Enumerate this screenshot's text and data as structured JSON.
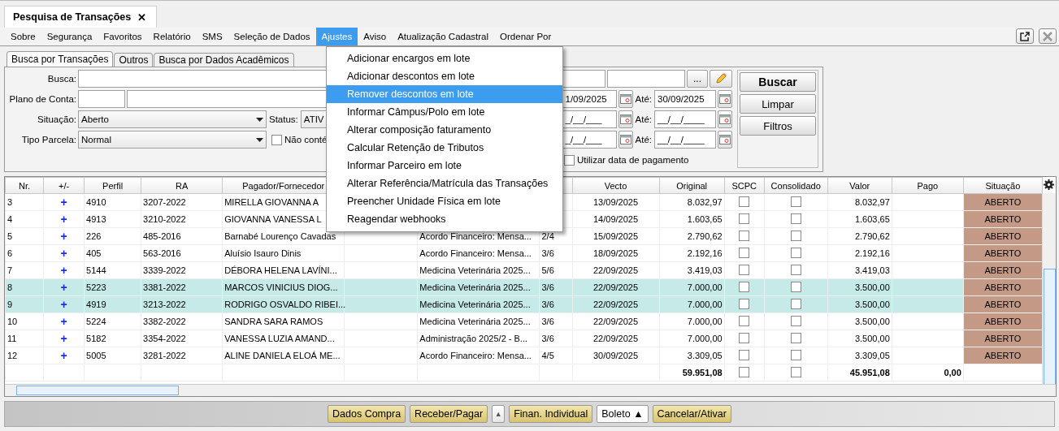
{
  "doc_tab": {
    "title": "Pesquisa de Transações",
    "close": "✕"
  },
  "menubar": [
    {
      "label": "Sobre",
      "selected": false
    },
    {
      "label": "Segurança",
      "selected": false
    },
    {
      "label": "Favoritos",
      "selected": false
    },
    {
      "label": "Relatório",
      "selected": false
    },
    {
      "label": "SMS",
      "selected": false
    },
    {
      "label": "Seleção de Dados",
      "selected": false
    },
    {
      "label": "Ajustes",
      "selected": true
    },
    {
      "label": "Aviso",
      "selected": false
    },
    {
      "label": "Atualização Cadastral",
      "selected": false
    },
    {
      "label": "Ordenar Por",
      "selected": false
    }
  ],
  "window_buttons": [
    {
      "kind": "popout",
      "disabled": false
    },
    {
      "kind": "close",
      "disabled": true
    }
  ],
  "dropdown_menu": [
    {
      "label": "Adicionar encargos em lote",
      "selected": false
    },
    {
      "label": "Adicionar descontos em lote",
      "selected": false
    },
    {
      "label": "Remover descontos em lote",
      "selected": true
    },
    {
      "label": "Informar Câmpus/Polo em lote",
      "selected": false
    },
    {
      "label": "Alterar composição faturamento",
      "selected": false
    },
    {
      "label": "Calcular Retenção de Tributos",
      "selected": false
    },
    {
      "label": "Informar Parceiro em lote",
      "selected": false
    },
    {
      "label": "Alterar Referência/Matrícula das Transações",
      "selected": false
    },
    {
      "label": "Preencher Unidade Física em lote",
      "selected": false
    },
    {
      "label": "Reagendar webhooks",
      "selected": false
    }
  ],
  "search_tabs": [
    {
      "label": "Busca por Transações",
      "selected": true
    },
    {
      "label": "Outros",
      "selected": false
    },
    {
      "label": "Busca por Dados Acadêmicos",
      "selected": false
    }
  ],
  "form": {
    "busca_label": "Busca:",
    "plano_label": "Plano de Conta:",
    "situacao_label": "Situação:",
    "situacao_value": "Aberto",
    "status_label": "Status:",
    "status_value": "ATIV",
    "tipo_label": "Tipo Parcela:",
    "tipo_value": "Normal",
    "nao_label": "Não conté",
    "nao_checked": false,
    "dots_button": "...",
    "date_rows": [
      {
        "from": "1/09/2025",
        "to_label": "Até:",
        "to": "30/09/2025"
      },
      {
        "from": "_/__/___",
        "to_label": "Até:",
        "to": "__/__/____"
      },
      {
        "from": "_/__/___",
        "to_label": "Até:",
        "to": "__/__/____"
      }
    ],
    "utilizar_label": "Utilizar data de pagamento",
    "utilizar_checked": false
  },
  "action_buttons": [
    {
      "label": "Buscar",
      "kind": "bold"
    },
    {
      "label": "Limpar",
      "kind": "normal"
    },
    {
      "label": "Filtros",
      "kind": "normal"
    }
  ],
  "table": {
    "columns": [
      "Nr.",
      "+/-",
      "Perfil",
      "RA",
      "Pagador/Fornecedor",
      "Vecto",
      "Original",
      "SCPC",
      "Consolidado",
      "Valor",
      "Pago",
      "Situação"
    ],
    "rows": [
      {
        "selected": false,
        "nr": "3",
        "sign": "+",
        "perfil": "4910",
        "ra": "3207-2022",
        "pagador": "MIRELLA GIOVANNA A",
        "vecto": "13/09/2025",
        "original": "8.032,97",
        "scpc": false,
        "consolidado": false,
        "valor": "8.032,97",
        "situacao": "ABERTO"
      },
      {
        "selected": false,
        "nr": "4",
        "sign": "+",
        "perfil": "4913",
        "ra": "3210-2022",
        "pagador": "GIOVANNA VANESSA L",
        "vecto": "14/09/2025",
        "original": "1.603,65",
        "scpc": false,
        "consolidado": false,
        "valor": "1.603,65",
        "situacao": "ABERTO"
      },
      {
        "selected": false,
        "nr": "5",
        "sign": "+",
        "perfil": "226",
        "ra": "485-2016",
        "pagador": "Barnabé Lourenço Cavadas",
        "column_7": "Acordo Financeiro: Mensa...",
        "column_8": "2/4",
        "vecto": "15/09/2025",
        "original": "2.790,62",
        "scpc": false,
        "consolidado": false,
        "valor": "2.790,62",
        "situacao": "ABERTO"
      },
      {
        "selected": false,
        "nr": "6",
        "sign": "+",
        "perfil": "405",
        "ra": "563-2016",
        "pagador": "Aluísio Isauro Dinis",
        "column_7": "Acordo Financeiro: Mensa...",
        "column_8": "3/6",
        "vecto": "18/09/2025",
        "original": "2.192,16",
        "scpc": false,
        "consolidado": false,
        "valor": "2.192,16",
        "situacao": "ABERTO"
      },
      {
        "selected": false,
        "nr": "7",
        "sign": "+",
        "perfil": "5144",
        "ra": "3339-2022",
        "pagador": "DÉBORA HELENA LAVÍNI...",
        "column_7": "Medicina Veterinária 2025...",
        "column_8": "5/6",
        "vecto": "22/09/2025",
        "original": "3.419,03",
        "scpc": false,
        "consolidado": false,
        "valor": "3.419,03",
        "situacao": "ABERTO"
      },
      {
        "selected": true,
        "nr": "8",
        "sign": "+",
        "perfil": "5223",
        "ra": "3381-2022",
        "pagador": "MARCOS VINICIUS DIOG...",
        "column_7": "Medicina Veterinária 2025...",
        "column_8": "3/6",
        "vecto": "22/09/2025",
        "original": "7.000,00",
        "scpc": false,
        "consolidado": false,
        "valor": "3.500,00",
        "situacao": "ABERTO"
      },
      {
        "selected": true,
        "nr": "9",
        "sign": "+",
        "perfil": "4919",
        "ra": "3213-2022",
        "pagador": "RODRIGO OSVALDO RIBEI...",
        "column_7": "Medicina Veterinária 2025...",
        "column_8": "3/6",
        "vecto": "22/09/2025",
        "original": "7.000,00",
        "scpc": false,
        "consolidado": false,
        "valor": "3.500,00",
        "situacao": "ABERTO"
      },
      {
        "selected": false,
        "nr": "10",
        "sign": "+",
        "perfil": "5224",
        "ra": "3382-2022",
        "pagador": "SANDRA SARA RAMOS",
        "column_7": "Medicina Veterinária 2025...",
        "column_8": "3/6",
        "vecto": "22/09/2025",
        "original": "7.000,00",
        "scpc": false,
        "consolidado": false,
        "valor": "3.500,00",
        "situacao": "ABERTO"
      },
      {
        "selected": false,
        "nr": "11",
        "sign": "+",
        "perfil": "5182",
        "ra": "3354-2022",
        "pagador": "VANESSA LUZIA AMAND...",
        "column_7": "Administração 2025/2 - B...",
        "column_8": "3/6",
        "vecto": "22/09/2025",
        "original": "7.000,00",
        "scpc": false,
        "consolidado": false,
        "valor": "3.500,00",
        "situacao": "ABERTO"
      },
      {
        "selected": false,
        "nr": "12",
        "sign": "+",
        "perfil": "5005",
        "ra": "3281-2022",
        "pagador": "ALINE DANIELA ELOÁ ME...",
        "column_7": "Acordo Financeiro: Mensa...",
        "column_8": "4/5",
        "vecto": "30/09/2025",
        "original": "3.309,05",
        "scpc": false,
        "consolidado": false,
        "valor": "3.309,05",
        "situacao": "ABERTO"
      }
    ],
    "totals": {
      "original": "59.951,08",
      "scpc": false,
      "consolidado": false,
      "valor": "45.951,08",
      "pago": "0,00"
    }
  },
  "bottom_buttons": [
    {
      "label": "Dados Compra",
      "kind": "primary"
    },
    {
      "label": "Receber/Pagar",
      "kind": "primary"
    },
    {
      "label": "▲",
      "kind": "arrow"
    },
    {
      "label": "Finan. Individual",
      "kind": "primary"
    },
    {
      "label": "Boleto ▲",
      "kind": "plain"
    },
    {
      "label": "Cancelar/Ativar",
      "kind": "primary"
    }
  ]
}
